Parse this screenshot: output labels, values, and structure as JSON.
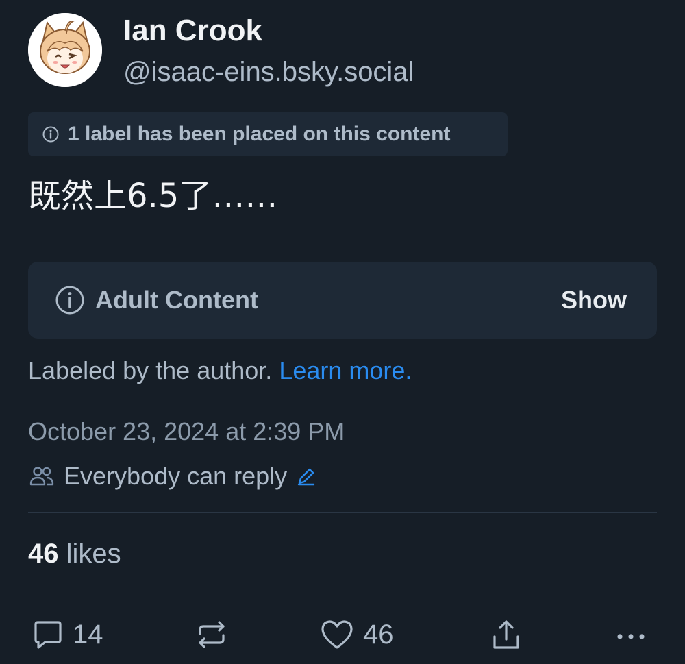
{
  "author": {
    "display_name": "Ian Crook",
    "handle": "@isaac-eins.bsky.social"
  },
  "content_label_notice": "1 label has been placed on this content",
  "post_text": "既然上6.5了……",
  "content_warning": {
    "title": "Adult Content",
    "show_label": "Show"
  },
  "label_source": {
    "text": "Labeled by the author.",
    "link": "Learn more."
  },
  "timestamp": "October 23, 2024 at 2:39 PM",
  "reply_setting": "Everybody can reply",
  "likes": {
    "count": "46",
    "label": "likes"
  },
  "actions": {
    "replies": "14",
    "likes": "46"
  },
  "colors": {
    "background": "#161e27",
    "card": "#1e2936",
    "link": "#2a8cf0",
    "muted": "#aebbc9"
  }
}
